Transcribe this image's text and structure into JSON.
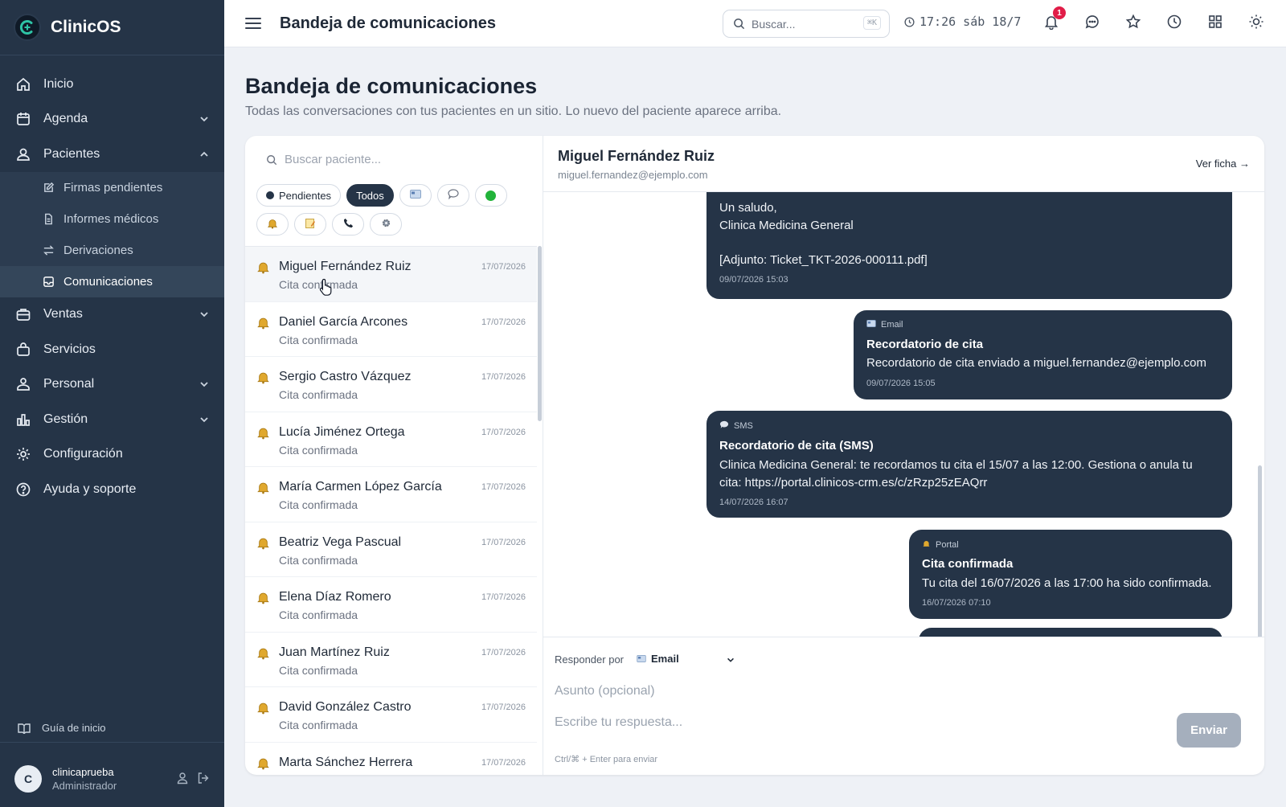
{
  "app": {
    "name": "ClinicOS"
  },
  "sidebar": {
    "items": [
      {
        "label": "Inicio",
        "icon": "home-icon"
      },
      {
        "label": "Agenda",
        "icon": "calendar-icon"
      },
      {
        "label": "Pacientes",
        "icon": "users-icon"
      }
    ],
    "sub_items": [
      {
        "label": "Firmas pendientes",
        "icon": "edit-icon"
      },
      {
        "label": "Informes médicos",
        "icon": "file-icon"
      },
      {
        "label": "Derivaciones",
        "icon": "arrows-icon"
      },
      {
        "label": "Comunicaciones",
        "icon": "inbox-icon"
      }
    ],
    "items_after": [
      {
        "label": "Ventas",
        "icon": "briefcase-icon"
      },
      {
        "label": "Servicios",
        "icon": "bag-icon"
      },
      {
        "label": "Personal",
        "icon": "staff-icon"
      },
      {
        "label": "Gestión",
        "icon": "chart-icon"
      },
      {
        "label": "Configuración",
        "icon": "gear-icon"
      },
      {
        "label": "Ayuda y soporte",
        "icon": "help-icon"
      }
    ],
    "guide": "Guía de inicio",
    "user": {
      "initial": "C",
      "name": "clinicaprueba",
      "role": "Administrador"
    }
  },
  "topbar": {
    "title": "Bandeja de comunicaciones",
    "search_placeholder": "Buscar...",
    "search_shortcut": "⌘K",
    "clock": "17:26 sáb 18/7",
    "notifications_count": "1"
  },
  "page": {
    "title": "Bandeja de comunicaciones",
    "subtitle": "Todas las conversaciones con tus pacientes en un sitio. Lo nuevo del paciente aparece arriba."
  },
  "list": {
    "search_placeholder": "Buscar paciente...",
    "filters": {
      "pending": "Pendientes",
      "all": "Todos"
    },
    "rows": [
      {
        "name": "Miguel Fernández Ruiz",
        "status": "Cita confirmada",
        "date": "17/07/2026"
      },
      {
        "name": "Daniel García Arcones",
        "status": "Cita confirmada",
        "date": "17/07/2026"
      },
      {
        "name": "Sergio Castro Vázquez",
        "status": "Cita confirmada",
        "date": "17/07/2026"
      },
      {
        "name": "Lucía Jiménez Ortega",
        "status": "Cita confirmada",
        "date": "17/07/2026"
      },
      {
        "name": "María Carmen López García",
        "status": "Cita confirmada",
        "date": "17/07/2026"
      },
      {
        "name": "Beatriz Vega Pascual",
        "status": "Cita confirmada",
        "date": "17/07/2026"
      },
      {
        "name": "Elena Díaz Romero",
        "status": "Cita confirmada",
        "date": "17/07/2026"
      },
      {
        "name": "Juan Martínez Ruiz",
        "status": "Cita confirmada",
        "date": "17/07/2026"
      },
      {
        "name": "David González Castro",
        "status": "Cita confirmada",
        "date": "17/07/2026"
      },
      {
        "name": "Marta Sánchez Herrera",
        "status": "",
        "date": "17/07/2026"
      }
    ]
  },
  "conversation": {
    "name": "Miguel Fernández Ruiz",
    "email": "miguel.fernandez@ejemplo.com",
    "view_link": "Ver ficha →",
    "messages": [
      {
        "body1": "Un saludo,",
        "body2": "Clinica Medicina General",
        "attachment": "[Adjunto: Ticket_TKT-2026-000111.pdf]",
        "time": "09/07/2026 15:03"
      },
      {
        "channel": "Email",
        "title": "Recordatorio de cita",
        "body": "Recordatorio de cita enviado a miguel.fernandez@ejemplo.com",
        "time": "09/07/2026 15:05"
      },
      {
        "channel": "SMS",
        "title": "Recordatorio de cita (SMS)",
        "body1": "Clinica Medicina General: te recordamos tu cita el 15/07 a las 12:00. Gestiona o anula tu",
        "body2": "cita: https://portal.clinicos-crm.es/c/zRzp25zEAQrr",
        "time": "14/07/2026 16:07"
      },
      {
        "channel": "Portal",
        "title": "Cita confirmada",
        "body": "Tu cita del 16/07/2026 a las 17:00 ha sido confirmada.",
        "time": "16/07/2026 07:10"
      }
    ]
  },
  "composer": {
    "reply_label": "Responder por",
    "reply_channel": "Email",
    "subject_placeholder": "Asunto (opcional)",
    "reply_placeholder": "Escribe tu respuesta...",
    "hint": "Ctrl/⌘ + Enter para enviar",
    "send_label": "Enviar"
  }
}
